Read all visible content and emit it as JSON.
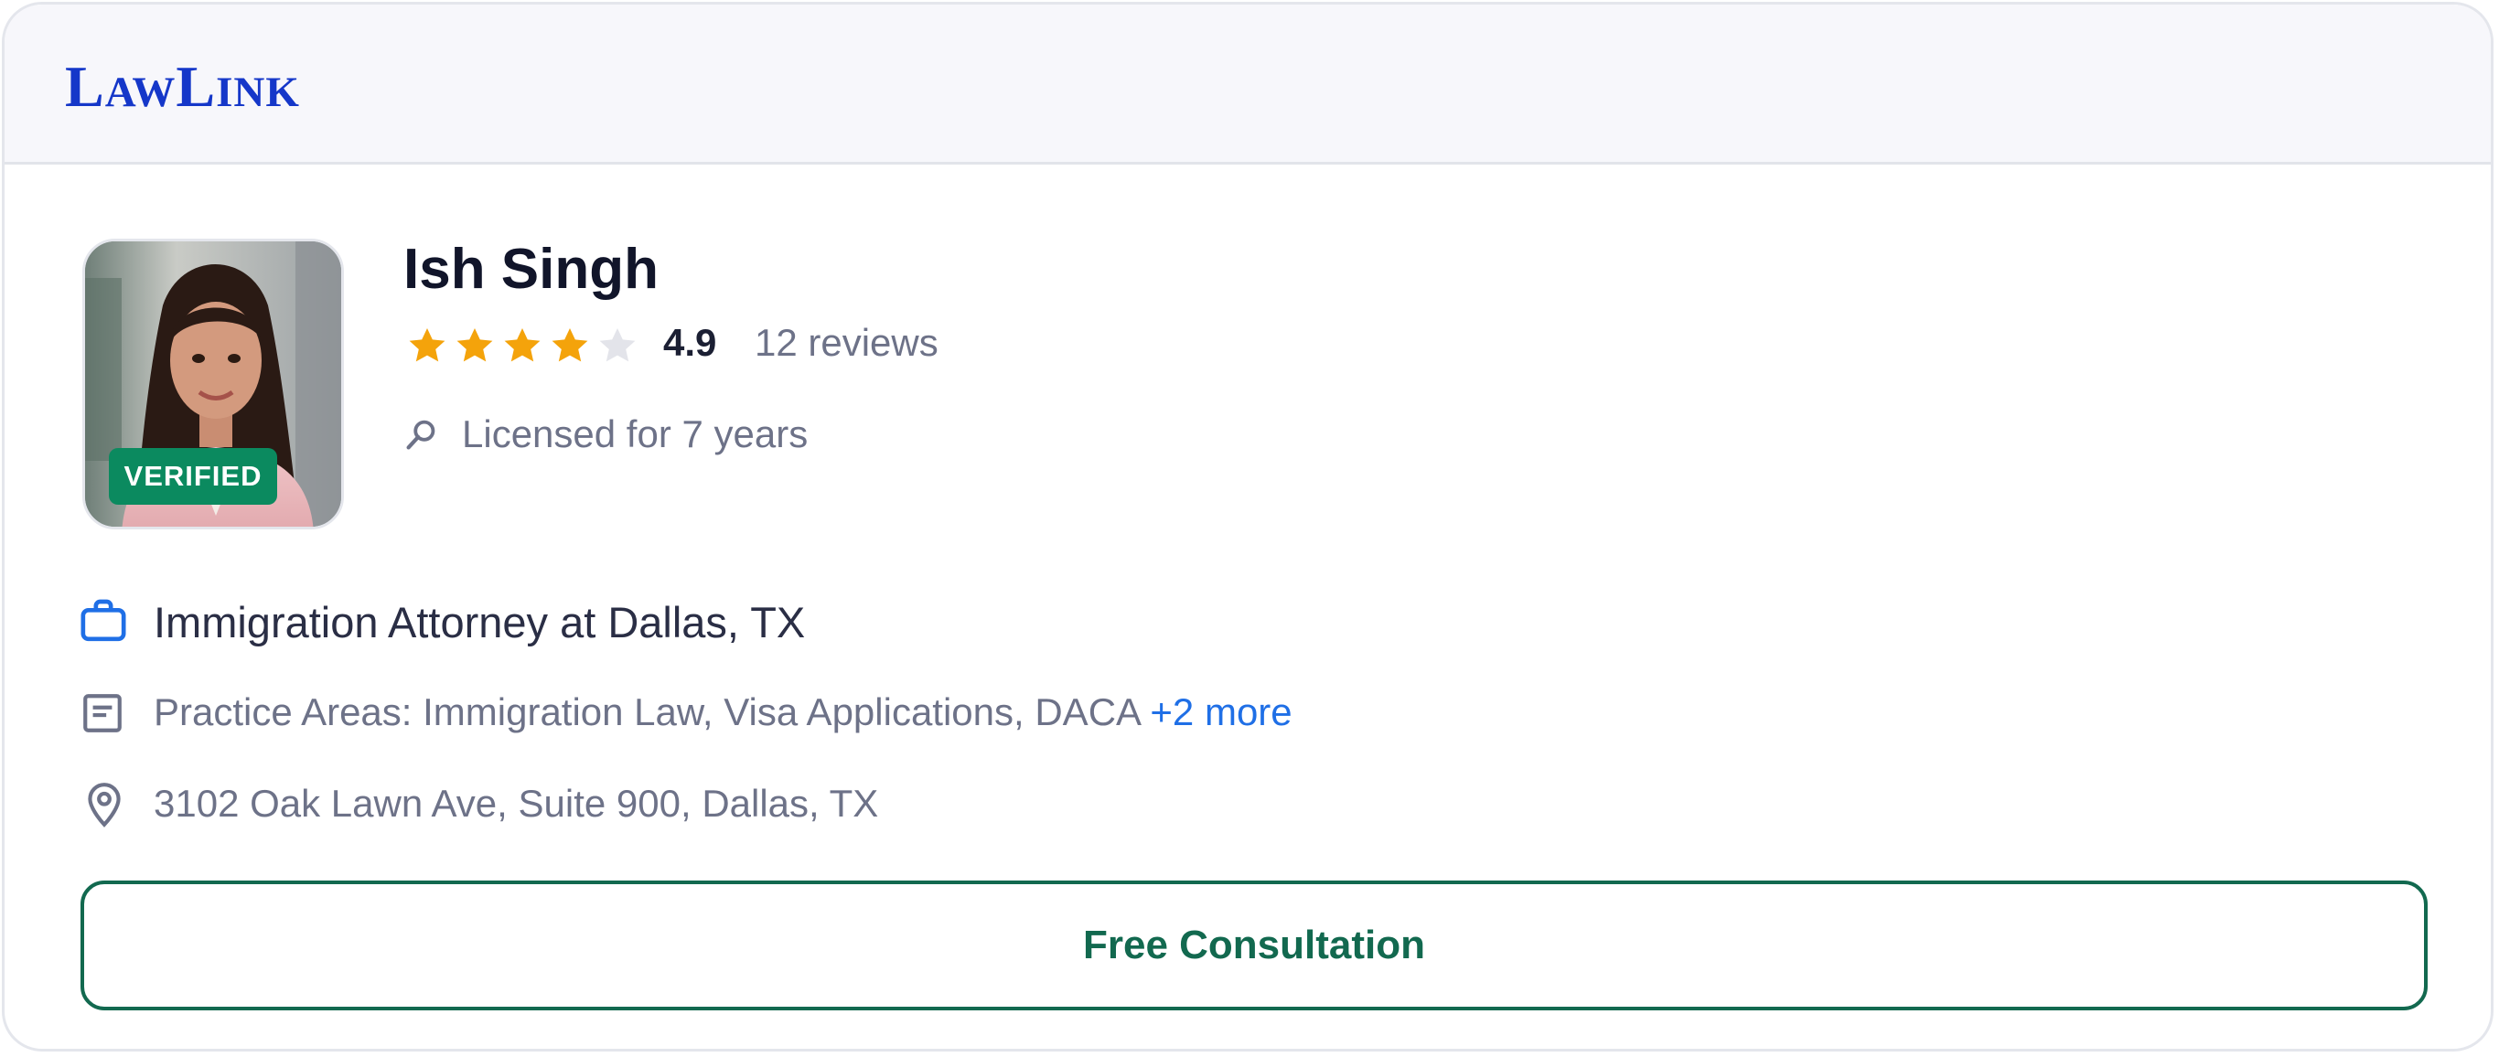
{
  "brand": {
    "logo_text": "LawLink",
    "logo_color": "#1537c9"
  },
  "profile": {
    "name": "Ish Singh",
    "verified_badge": "VERIFIED",
    "rating": {
      "value": 4.9,
      "display": "4.9",
      "stars_filled": 4,
      "stars_total": 5,
      "reviews_label": "12 reviews"
    },
    "licensed_label": "Licensed for 7 years",
    "title_line": "Immigration Attorney at Dallas, TX",
    "practice_areas": {
      "label": "Practice Areas: Immigration Law, Visa Applications, DACA",
      "more_link": "+2 more"
    },
    "address": "3102 Oak Lawn Ave, Suite 900, Dallas, TX"
  },
  "actions": {
    "consultation_button": "Free Consultation"
  },
  "colors": {
    "star_filled": "#f4a30b",
    "star_empty": "#e3e4ea",
    "verified_bg": "#0b8a5f",
    "cta_accent": "#12694f",
    "link": "#1f6fe6"
  },
  "icons": {
    "title": "briefcase-icon",
    "practice": "document-icon",
    "address": "location-pin-icon",
    "licensed": "search-icon"
  }
}
